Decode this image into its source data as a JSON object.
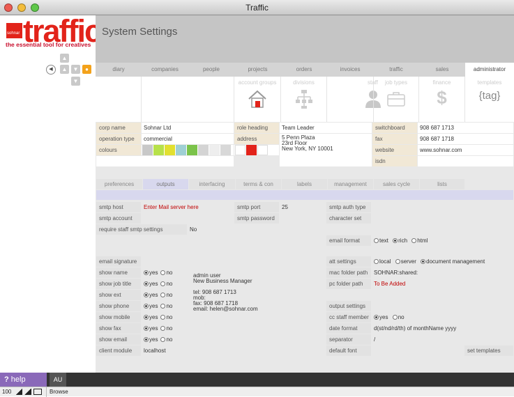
{
  "window": {
    "title": "Traffic"
  },
  "logo": {
    "brand": "sohnar",
    "word": "traffic",
    "tagline": "the essential tool for creatives"
  },
  "page": {
    "title": "System Settings"
  },
  "tabs": [
    "diary",
    "companies",
    "people",
    "projects",
    "orders",
    "invoices",
    "traffic",
    "sales",
    "administrator"
  ],
  "icons": [
    {
      "label": "account groups",
      "icon": "house-icon"
    },
    {
      "label": "divisions",
      "icon": "org-chart-icon"
    },
    {
      "label": "staff",
      "icon": "person-icon"
    },
    {
      "label": "job types",
      "icon": "briefcase-icon"
    },
    {
      "label": "finance",
      "icon": "dollar-icon"
    },
    {
      "label": "templates",
      "icon": "tag-icon",
      "glyph": "{tag}"
    }
  ],
  "company": {
    "corp_name_label": "corp name",
    "corp_name": "Sohnar Ltd",
    "op_type_label": "operation type",
    "op_type": "commercial",
    "colours_label": "colours",
    "colours": [
      "#c8c8c8",
      "#b7e14a",
      "#e2e030",
      "#9fd0d4",
      "#7bc34a",
      "#d4d4d4",
      "#eeeeee",
      "#d8d8d8"
    ],
    "role_heading_label": "role heading",
    "role_heading": "Team Leader",
    "address_label": "address",
    "address_lines": [
      "5 Penn Plaza",
      "23rd Floor",
      "New York, NY 10001"
    ],
    "address_colours": [
      "#ffffff",
      "#e2231a",
      "#ffffff"
    ],
    "switchboard_label": "switchboard",
    "switchboard": "908 687 1713",
    "fax_label": "fax",
    "fax": "908 687 1718",
    "website_label": "website",
    "website": "www.sohnar.com",
    "isdn_label": "isdn"
  },
  "subtabs": [
    "preferences",
    "outputs",
    "interfacing",
    "terms & con",
    "labels",
    "management",
    "sales cycle",
    "lists"
  ],
  "outputs": {
    "smtp_host_label": "smtp host",
    "smtp_host": "Enter Mail server here",
    "smtp_account_label": "smtp account",
    "req_staff_label": "require staff smtp settings",
    "req_staff": "No",
    "smtp_port_label": "smtp port",
    "smtp_port": "25",
    "smtp_password_label": "smtp password",
    "smtp_auth_label": "smtp auth type",
    "charset_label": "character set",
    "email_format_label": "email format",
    "email_format_opts": [
      "text",
      "rich",
      "html"
    ],
    "email_format_selected": 1,
    "email_sig_label": "email signature",
    "show_rows": [
      "show name",
      "show job title",
      "show ext",
      "show phone",
      "show mobile",
      "show fax",
      "show email"
    ],
    "yes": "yes",
    "no": "no",
    "client_module_label": "client module",
    "client_module": "localhost",
    "signature_lines": [
      "admin user",
      "New Business Manager",
      "",
      "tel: 908 687 1713",
      "mob:",
      "fax: 908 687 1718",
      "email: helen@sohnar.com"
    ],
    "att_label": "att settings",
    "att_opts": [
      "local",
      "server",
      "document management"
    ],
    "att_selected": 2,
    "mac_label": "mac folder path",
    "mac_value": "SOHNAR:shared:",
    "pc_label": "pc folder path",
    "pc_value": "To Be Added",
    "output_settings_label": "output settings",
    "cc_label": "cc staff member",
    "date_format_label": "date format",
    "date_format": "d(st/nd/rd/th) of monthName yyyy",
    "separator_label": "separator",
    "separator": "/",
    "default_font_label": "default font",
    "set_templates_label": "set templates"
  },
  "footer": {
    "help": "help",
    "user": "AU"
  },
  "status": {
    "zoom": "100",
    "mode": "Browse"
  }
}
